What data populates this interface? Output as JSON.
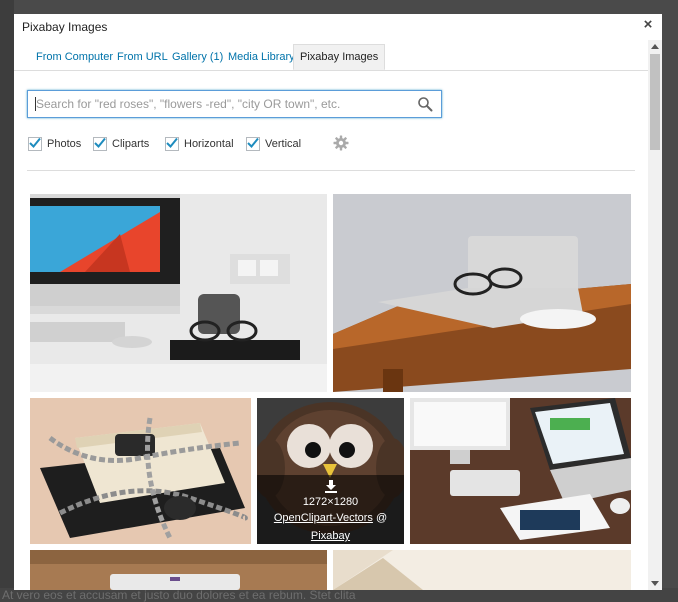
{
  "modal": {
    "title": "Pixabay Images",
    "close_glyph": "×"
  },
  "tabs": [
    {
      "label": "From Computer",
      "active": false
    },
    {
      "label": "From URL",
      "active": false
    },
    {
      "label": "Gallery (1)",
      "active": false
    },
    {
      "label": "Media Library",
      "active": false
    },
    {
      "label": "Pixabay Images",
      "active": true
    }
  ],
  "search": {
    "placeholder": "Search for \"red roses\", \"flowers -red\", \"city OR town\", etc.",
    "value": ""
  },
  "filters": [
    {
      "label": "Photos",
      "checked": true
    },
    {
      "label": "Cliparts",
      "checked": true
    },
    {
      "label": "Horizontal",
      "checked": true
    },
    {
      "label": "Vertical",
      "checked": true
    }
  ],
  "hover_overlay": {
    "dimensions": "1272×1280",
    "author_link": "OpenClipart-Vectors",
    "at": "@",
    "source_link": "Pixabay"
  },
  "colors": {
    "accent": "#0073aa",
    "focus": "#5b9dd9"
  },
  "background_page": {
    "bottom_text": "At vero eos et accusam et justo duo dolores et ea rebum. Stet clita"
  }
}
